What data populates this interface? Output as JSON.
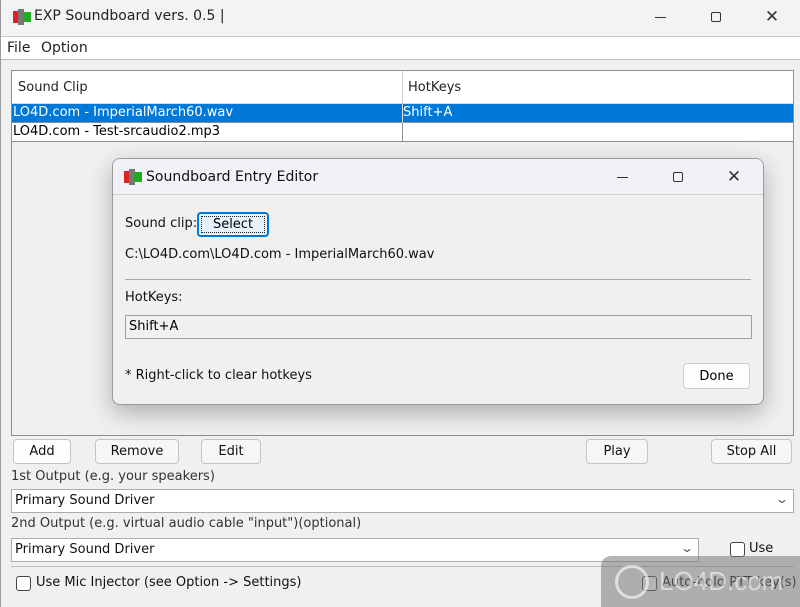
{
  "window": {
    "title": "EXP Soundboard vers. 0.5 |",
    "icon": "exp-app-icon",
    "controls": {
      "minimize": "minimize-icon",
      "maximize": "maximize-icon",
      "close": "close-icon",
      "close_glyph": "✕"
    }
  },
  "menu": {
    "items": [
      {
        "label": "File"
      },
      {
        "label": "Option"
      }
    ]
  },
  "table": {
    "columns": [
      "Sound Clip",
      "HotKeys"
    ],
    "rows": [
      {
        "sound_clip": "LO4D.com - ImperialMarch60.wav",
        "hotkeys": "Shift+A",
        "selected": true
      },
      {
        "sound_clip": "LO4D.com - Test-srcaudio2.mp3",
        "hotkeys": "",
        "selected": false
      }
    ],
    "selection_color": "#0078d7"
  },
  "buttons": {
    "add": "Add",
    "remove": "Remove",
    "edit": "Edit",
    "play": "Play",
    "stop_all": "Stop All"
  },
  "outputs": {
    "first_label": "1st Output (e.g. your speakers)",
    "first_value": "Primary Sound Driver",
    "second_label": "2nd Output (e.g. virtual audio cable \"input\")(optional)",
    "second_value": "Primary Sound Driver",
    "chevron": "⌄",
    "use_label": "Use",
    "use_checked": false
  },
  "options": {
    "mic_injector_label": "Use Mic Injector (see Option -> Settings)",
    "mic_injector_checked": false,
    "auto_hold_label": "Auto-hold PTT key(s)",
    "auto_hold_checked": false
  },
  "watermark": {
    "text": "LO4D.com"
  },
  "dialog": {
    "title": "Soundboard Entry Editor",
    "sound_clip_label": "Sound clip:",
    "select_button": "Select",
    "file_path": "C:\\LO4D.com\\LO4D.com - ImperialMarch60.wav",
    "hotkeys_label": "HotKeys:",
    "hotkeys_value": "Shift+A",
    "note": "* Right-click to clear hotkeys",
    "done_button": "Done",
    "close_glyph": "✕"
  }
}
